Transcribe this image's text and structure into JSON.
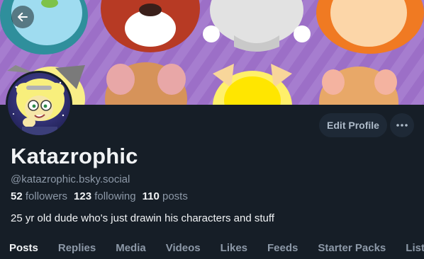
{
  "header": {
    "back_icon": "arrow-left-icon"
  },
  "profile": {
    "display_name": "Katazrophic",
    "handle": "@katazrophic.bsky.social",
    "bio": "25 yr old dude who's just drawin his characters and stuff",
    "stats": {
      "followers_count": "52",
      "followers_label": "followers",
      "following_count": "123",
      "following_label": "following",
      "posts_count": "110",
      "posts_label": "posts"
    }
  },
  "actions": {
    "edit_profile_label": "Edit Profile",
    "more_icon": "ellipsis-icon"
  },
  "tabs": [
    {
      "label": "Posts",
      "active": true
    },
    {
      "label": "Replies",
      "active": false
    },
    {
      "label": "Media",
      "active": false
    },
    {
      "label": "Videos",
      "active": false
    },
    {
      "label": "Likes",
      "active": false
    },
    {
      "label": "Feeds",
      "active": false
    },
    {
      "label": "Starter Packs",
      "active": false
    },
    {
      "label": "Lists",
      "active": false
    }
  ],
  "colors": {
    "background": "#161e27",
    "button_bg": "#1e2936",
    "muted_text": "#8d99a8",
    "primary_text": "#f1f3f5",
    "banner_purple": "#a77ccf"
  }
}
